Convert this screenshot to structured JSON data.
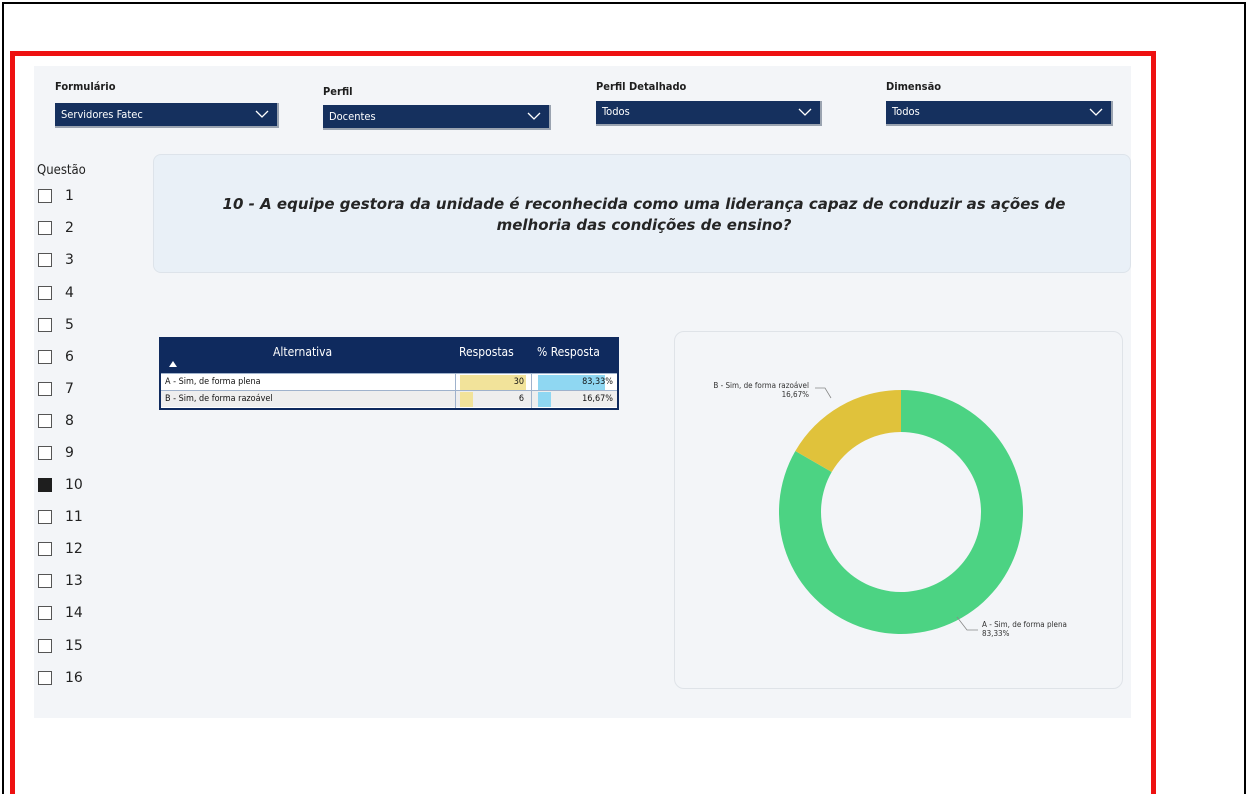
{
  "filters": [
    {
      "label": "Formulário",
      "value": "Servidores Fatec"
    },
    {
      "label": "Perfil",
      "value": "Docentes"
    },
    {
      "label": "Perfil Detalhado",
      "value": "Todos"
    },
    {
      "label": "Dimensão",
      "value": "Todos"
    }
  ],
  "questoes": {
    "title": "Questão",
    "items": [
      "1",
      "2",
      "3",
      "4",
      "5",
      "6",
      "7",
      "8",
      "9",
      "10",
      "11",
      "12",
      "13",
      "14",
      "15",
      "16"
    ],
    "selected": "10"
  },
  "question": {
    "text": "10 - A equipe gestora da unidade é reconhecida como uma liderança capaz de conduzir as ações de melhoria das condições de ensino?"
  },
  "table": {
    "columns": [
      "Alternativa",
      "Respostas",
      "% Resposta"
    ],
    "sort_icon": "sort-up-triangle-icon",
    "rows": [
      {
        "alternativa": "A - Sim, de forma plena",
        "respostas": "30",
        "percent": "83,33%",
        "respostas_value": 30,
        "percent_value": 83.33
      },
      {
        "alternativa": "B - Sim, de forma razoável",
        "respostas": "6",
        "percent": "16,67%",
        "respostas_value": 6,
        "percent_value": 16.67
      }
    ],
    "colors": {
      "header": "#0f2a5e",
      "respostas_bar": "#f2e39a",
      "percent_bar": "#8fd7f2",
      "row_alt": "#eeeeee"
    }
  },
  "chart_data": {
    "type": "pie",
    "categories": [
      "A - Sim, de forma plena",
      "B - Sim, de forma razoável"
    ],
    "values": [
      83.33,
      16.67
    ],
    "labels": [
      "83,33%",
      "16,67%"
    ],
    "colors": [
      "#4cd383",
      "#e0c23b"
    ]
  },
  "colors": {
    "frame": "#ee1111",
    "dropdown": "#15305e",
    "canvas": "#f3f5f8"
  }
}
